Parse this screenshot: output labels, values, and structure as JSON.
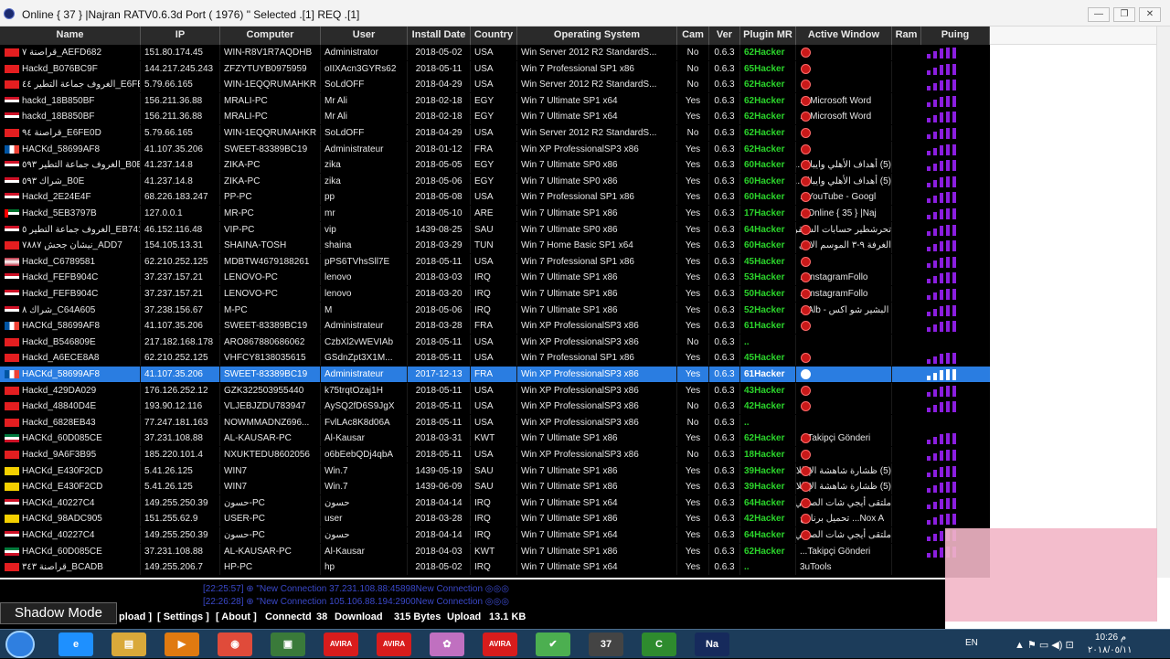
{
  "window": {
    "title": "Online { 37 } |Najran RATV0.6.3d  Port  ( 1976) \" Selected  .[1] REQ .[1]"
  },
  "columns": [
    {
      "key": "name",
      "label": "Name"
    },
    {
      "key": "ip",
      "label": "IP"
    },
    {
      "key": "computer",
      "label": "Computer"
    },
    {
      "key": "user",
      "label": "User"
    },
    {
      "key": "install",
      "label": "Install Date"
    },
    {
      "key": "country",
      "label": "Country"
    },
    {
      "key": "os",
      "label": "Operating System"
    },
    {
      "key": "cam",
      "label": "Cam"
    },
    {
      "key": "ver",
      "label": "Ver"
    },
    {
      "key": "plugin",
      "label": "Plugin MR"
    },
    {
      "key": "activewin",
      "label": "Active Window"
    },
    {
      "key": "ram",
      "label": "Ram"
    },
    {
      "key": "ping",
      "label": "Puing"
    }
  ],
  "rows": [
    {
      "flag": "tun",
      "name": "قراصنة ٧_AEFD682",
      "ip": "151.80.174.45",
      "computer": "WIN-R8V1R7AQDHB",
      "user": "Administrator",
      "install": "2018-05-02",
      "country": "USA",
      "os": "Win Server 2012 R2 StandardS...",
      "cam": "No",
      "ver": "0.6.3",
      "plugin": "62Hacker",
      "dot": true,
      "activewin": "",
      "ping": 4
    },
    {
      "flag": "tun",
      "name": "Hackd_B076BC9F",
      "ip": "144.217.245.243",
      "computer": "ZFZYTUYB0975959",
      "user": "oIIXAcn3GYRs62",
      "install": "2018-05-11",
      "country": "USA",
      "os": "Win 7 Professional SP1 x86",
      "cam": "No",
      "ver": "0.6.3",
      "plugin": "65Hacker",
      "dot": true,
      "activewin": "",
      "ping": 4
    },
    {
      "flag": "tun",
      "name": "الغروف جماعة التطير ٤٤_E6FE0D",
      "ip": "5.79.66.165",
      "computer": "WIN-1EQQRUMAHKR",
      "user": "SoLdOFF",
      "install": "2018-04-29",
      "country": "USA",
      "os": "Win Server 2012 R2 StandardS...",
      "cam": "No",
      "ver": "0.6.3",
      "plugin": "62Hacker",
      "dot": true,
      "activewin": "",
      "ping": 4
    },
    {
      "flag": "egy",
      "name": "hackd_18B850BF",
      "ip": "156.211.36.88",
      "computer": "MRALI-PC",
      "user": "Mr Ali",
      "install": "2018-02-18",
      "country": "EGY",
      "os": "Win 7 Ultimate SP1 x64",
      "cam": "Yes",
      "ver": "0.6.3",
      "plugin": "62Hacker",
      "dot": true,
      "activewin": "Microsoft Word ...",
      "ping": 4
    },
    {
      "flag": "egy",
      "name": "hackd_18B850BF",
      "ip": "156.211.36.88",
      "computer": "MRALI-PC",
      "user": "Mr Ali",
      "install": "2018-02-18",
      "country": "EGY",
      "os": "Win 7 Ultimate SP1 x64",
      "cam": "Yes",
      "ver": "0.6.3",
      "plugin": "62Hacker",
      "dot": true,
      "activewin": "Microsoft Word ...",
      "ping": 4
    },
    {
      "flag": "tun",
      "name": "قراصنة ٩٤_E6FE0D",
      "ip": "5.79.66.165",
      "computer": "WIN-1EQQRUMAHKR",
      "user": "SoLdOFF",
      "install": "2018-04-29",
      "country": "USA",
      "os": "Win Server 2012 R2 StandardS...",
      "cam": "No",
      "ver": "0.6.3",
      "plugin": "62Hacker",
      "dot": true,
      "activewin": "",
      "ping": 4
    },
    {
      "flag": "fra",
      "name": "HACKd_58699AF8",
      "ip": "41.107.35.206",
      "computer": "SWEET-83389BC19",
      "user": "Administrateur",
      "install": "2018-01-12",
      "country": "FRA",
      "os": "Win XP ProfessionalSP3 x86",
      "cam": "Yes",
      "ver": "0.6.3",
      "plugin": "62Hacker",
      "dot": true,
      "activewin": "",
      "ping": 4
    },
    {
      "flag": "egy",
      "name": "الغروف جماعة التطير ٥٩٣_B0E",
      "ip": "41.237.14.8",
      "computer": "ZIKA-PC",
      "user": "zika",
      "install": "2018-05-05",
      "country": "EGY",
      "os": "Win 7 Ultimate SP0 x86",
      "cam": "Yes",
      "ver": "0.6.3",
      "plugin": "60Hacker",
      "dot": true,
      "activewin": "(5) أهداف الأهلي وايباك ...",
      "ping": 4
    },
    {
      "flag": "egy",
      "name": "شراك ٥٩٣_B0E",
      "ip": "41.237.14.8",
      "computer": "ZIKA-PC",
      "user": "zika",
      "install": "2018-05-06",
      "country": "EGY",
      "os": "Win 7 Ultimate SP0 x86",
      "cam": "Yes",
      "ver": "0.6.3",
      "plugin": "60Hacker",
      "dot": true,
      "activewin": "(5) أهداف الأهلي وايباك ...",
      "ping": 4
    },
    {
      "flag": "egy",
      "name": "Hackd_2E24E4F",
      "ip": "68.226.183.247",
      "computer": "PP-PC",
      "user": "pp",
      "install": "2018-05-08",
      "country": "USA",
      "os": "Win 7 Professional SP1 x86",
      "cam": "Yes",
      "ver": "0.6.3",
      "plugin": "60Hacker",
      "dot": true,
      "activewin": "YouTube - Googl...",
      "ping": 4
    },
    {
      "flag": "are",
      "name": "Hackd_5EB3797B",
      "ip": "127.0.0.1",
      "computer": "MR-PC",
      "user": "mr",
      "install": "2018-05-10",
      "country": "ARE",
      "os": "Win 7 Ultimate SP1 x86",
      "cam": "Yes",
      "ver": "0.6.3",
      "plugin": "17Hacker",
      "dot": true,
      "activewin": "Online { 35 } |Naj...",
      "ping": 4
    },
    {
      "flag": "egy",
      "name": "الغروف جماعة التطير ٥_EB741...",
      "ip": "46.152.116.48",
      "computer": "VIP-PC",
      "user": "vip",
      "install": "1439-08-25",
      "country": "SAU",
      "os": "Win 7 Ultimate SP0 x86",
      "cam": "Yes",
      "ver": "0.6.3",
      "plugin": "64Hacker",
      "dot": true,
      "activewin": "تحرشطير حسابات الستقرا...",
      "ping": 4
    },
    {
      "flag": "tun",
      "name": "نيشان جحش ٧٨٨٧_ADD7",
      "ip": "154.105.13.31",
      "computer": "SHAINA-TOSH",
      "user": "shaina",
      "install": "2018-03-29",
      "country": "TUN",
      "os": "Win 7 Home Basic SP1 x64",
      "cam": "Yes",
      "ver": "0.6.3",
      "plugin": "60Hacker",
      "dot": true,
      "activewin": "الغرفة ٩-٣ الموسم الاول ...",
      "ping": 4
    },
    {
      "flag": "usa",
      "name": "Hackd_C6789581",
      "ip": "62.210.252.125",
      "computer": "MDBTW4679188261",
      "user": "pPS6TVhsSll7E",
      "install": "2018-05-11",
      "country": "USA",
      "os": "Win 7 Professional SP1 x86",
      "cam": "Yes",
      "ver": "0.6.3",
      "plugin": "45Hacker",
      "dot": true,
      "activewin": "",
      "ping": 4
    },
    {
      "flag": "egy",
      "name": "Hackd_FEFB904C",
      "ip": "37.237.157.21",
      "computer": "LENOVO-PC",
      "user": "lenovo",
      "install": "2018-03-03",
      "country": "IRQ",
      "os": "Win 7 Ultimate SP1 x86",
      "cam": "Yes",
      "ver": "0.6.3",
      "plugin": "53Hacker",
      "dot": true,
      "activewin": "InstagramFollo...",
      "ping": 4
    },
    {
      "flag": "egy",
      "name": "Hackd_FEFB904C",
      "ip": "37.237.157.21",
      "computer": "LENOVO-PC",
      "user": "lenovo",
      "install": "2018-03-20",
      "country": "IRQ",
      "os": "Win 7 Ultimate SP1 x86",
      "cam": "Yes",
      "ver": "0.6.3",
      "plugin": "50Hacker",
      "dot": true,
      "activewin": "InstagramFollo...",
      "ping": 4
    },
    {
      "flag": "egy",
      "name": "شراك ٨_C64A605",
      "ip": "37.238.156.67",
      "computer": "M-PC",
      "user": "M",
      "install": "2018-05-06",
      "country": "IRQ",
      "os": "Win 7 Ultimate SP1 x86",
      "cam": "Yes",
      "ver": "0.6.3",
      "plugin": "52Hacker",
      "dot": true,
      "activewin": "البشير شو اكس - Alb...",
      "ping": 4
    },
    {
      "flag": "fra",
      "name": "HACKd_58699AF8",
      "ip": "41.107.35.206",
      "computer": "SWEET-83389BC19",
      "user": "Administrateur",
      "install": "2018-03-28",
      "country": "FRA",
      "os": "Win XP ProfessionalSP3 x86",
      "cam": "Yes",
      "ver": "0.6.3",
      "plugin": "61Hacker",
      "dot": true,
      "activewin": "",
      "ping": 4
    },
    {
      "flag": "tun",
      "name": "Hackd_B546809E",
      "ip": "217.182.168.178",
      "computer": "ARO867880686062",
      "user": "CzbXl2vWEVIAb",
      "install": "2018-05-11",
      "country": "USA",
      "os": "Win XP ProfessionalSP3 x86",
      "cam": "No",
      "ver": "0.6.3",
      "plugin": "..",
      "dot": false,
      "activewin": "",
      "ping": 0
    },
    {
      "flag": "tun",
      "name": "Hackd_A6ECE8A8",
      "ip": "62.210.252.125",
      "computer": "VHFCY8138035615",
      "user": "GSdnZpt3X1M...",
      "install": "2018-05-11",
      "country": "USA",
      "os": "Win 7 Professional SP1 x86",
      "cam": "Yes",
      "ver": "0.6.3",
      "plugin": "45Hacker",
      "dot": true,
      "activewin": "",
      "ping": 4
    },
    {
      "flag": "fra",
      "name": "HACKd_58699AF8",
      "ip": "41.107.35.206",
      "computer": "SWEET-83389BC19",
      "user": "Administrateur",
      "install": "2017-12-13",
      "country": "FRA",
      "os": "Win XP ProfessionalSP3 x86",
      "cam": "Yes",
      "ver": "0.6.3",
      "plugin": "61Hacker",
      "dot": true,
      "activewin": "",
      "ping": 4,
      "selected": true
    },
    {
      "flag": "tun",
      "name": "Hackd_429DA029",
      "ip": "176.126.252.12",
      "computer": "GZK322503955440",
      "user": "k75trqtOzaj1H",
      "install": "2018-05-11",
      "country": "USA",
      "os": "Win XP ProfessionalSP3 x86",
      "cam": "Yes",
      "ver": "0.6.3",
      "plugin": "43Hacker",
      "dot": true,
      "activewin": "",
      "ping": 4
    },
    {
      "flag": "tun",
      "name": "Hackd_48840D4E",
      "ip": "193.90.12.116",
      "computer": "VLJEBJZDU783947",
      "user": "AySQ2fD6S9JgX",
      "install": "2018-05-11",
      "country": "USA",
      "os": "Win XP ProfessionalSP3 x86",
      "cam": "No",
      "ver": "0.6.3",
      "plugin": "42Hacker",
      "dot": true,
      "activewin": "",
      "ping": 4
    },
    {
      "flag": "tun",
      "name": "Hackd_6828EB43",
      "ip": "77.247.181.163",
      "computer": "NOWMMADNZ696...",
      "user": "FvlLAc8K8d06A",
      "install": "2018-05-11",
      "country": "USA",
      "os": "Win XP ProfessionalSP3 x86",
      "cam": "No",
      "ver": "0.6.3",
      "plugin": "..",
      "dot": false,
      "activewin": "",
      "ping": 0
    },
    {
      "flag": "kwt",
      "name": "HACKd_60D085CE",
      "ip": "37.231.108.88",
      "computer": "AL-KAUSAR-PC",
      "user": "Al-Kausar",
      "install": "2018-03-31",
      "country": "KWT",
      "os": "Win 7 Ultimate SP1 x86",
      "cam": "Yes",
      "ver": "0.6.3",
      "plugin": "62Hacker",
      "dot": true,
      "activewin": "Takipçi Gönderi...",
      "ping": 4
    },
    {
      "flag": "tun",
      "name": "Hackd_9A6F3B95",
      "ip": "185.220.101.4",
      "computer": "NXUKTEDU8602056",
      "user": "o6bEebQDj4qbA",
      "install": "2018-05-11",
      "country": "USA",
      "os": "Win XP ProfessionalSP3 x86",
      "cam": "No",
      "ver": "0.6.3",
      "plugin": "18Hacker",
      "dot": true,
      "activewin": "",
      "ping": 4
    },
    {
      "flag": "sau",
      "name": "HACKd_E430F2CD",
      "ip": "5.41.26.125",
      "computer": "WIN7",
      "user": "Win.7",
      "install": "1439-05-19",
      "country": "SAU",
      "os": "Win 7 Ultimate SP1 x86",
      "cam": "Yes",
      "ver": "0.6.3",
      "plugin": "39Hacker",
      "dot": true,
      "activewin": "(5) ظشارة شاهشة الإطلاة ...",
      "ping": 4
    },
    {
      "flag": "sau",
      "name": "HACKd_E430F2CD",
      "ip": "5.41.26.125",
      "computer": "WIN7",
      "user": "Win.7",
      "install": "1439-06-09",
      "country": "SAU",
      "os": "Win 7 Ultimate SP1 x86",
      "cam": "Yes",
      "ver": "0.6.3",
      "plugin": "39Hacker",
      "dot": true,
      "activewin": "(5) ظشارة شاهشة الإطلاة ...",
      "ping": 4
    },
    {
      "flag": "egy",
      "name": "HACKd_40227C4",
      "ip": "149.255.250.39",
      "computer": "حسون-PC",
      "user": "حسون",
      "install": "2018-04-14",
      "country": "IRQ",
      "os": "Win 7 Ultimate SP1 x64",
      "cam": "Yes",
      "ver": "0.6.3",
      "plugin": "64Hacker",
      "dot": true,
      "activewin": "ملتقى أيجي شات الصوتي ...",
      "ping": 4
    },
    {
      "flag": "sau",
      "name": "HACKd_98ADC905",
      "ip": "151.255.62.9",
      "computer": "USER-PC",
      "user": "user",
      "install": "2018-03-28",
      "country": "IRQ",
      "os": "Win 7 Ultimate SP1 x86",
      "cam": "Yes",
      "ver": "0.6.3",
      "plugin": "42Hacker",
      "dot": true,
      "activewin": "Nox A... تحميل برنامج",
      "ping": 4
    },
    {
      "flag": "egy",
      "name": "HACKd_40227C4",
      "ip": "149.255.250.39",
      "computer": "حسون-PC",
      "user": "حسون",
      "install": "2018-04-14",
      "country": "IRQ",
      "os": "Win 7 Ultimate SP1 x64",
      "cam": "Yes",
      "ver": "0.6.3",
      "plugin": "64Hacker",
      "dot": true,
      "activewin": "ملتقى أيجي شات الصوتي ...",
      "ping": 4
    },
    {
      "flag": "kwt",
      "name": "HACKd_60D085CE",
      "ip": "37.231.108.88",
      "computer": "AL-KAUSAR-PC",
      "user": "Al-Kausar",
      "install": "2018-04-03",
      "country": "KWT",
      "os": "Win 7 Ultimate SP1 x86",
      "cam": "Yes",
      "ver": "0.6.3",
      "plugin": "62Hacker",
      "dot": false,
      "activewin": "Takipçi Gönderi...",
      "ping": 4
    },
    {
      "flag": "tun",
      "name": "قراصنة ٣٤٣_BCADB",
      "ip": "149.255.206.7",
      "computer": "HP-PC",
      "user": "hp",
      "install": "2018-05-02",
      "country": "IRQ",
      "os": "Win 7 Ultimate SP1 x64",
      "cam": "Yes",
      "ver": "0.6.3",
      "plugin": "..",
      "dot": false,
      "activewin": "3uTools",
      "ping": 0
    }
  ],
  "log": [
    "[22:25:57]  ⊕ \"New Connection 37.231.108.88:45898New Connection ◎◎◎",
    "[22:26:28]  ⊕ \"New Connection 105.106.88.194:2900New Connection ◎◎◎"
  ],
  "status": {
    "upload_tab": "pload ]",
    "settings": "[ Settings ]",
    "about": "[ About ]",
    "connected_label": "Connectd",
    "connected_count": "38",
    "download_label": "Download",
    "download_value": "315 Bytes",
    "upload_label": "Upload",
    "upload_value": "13.1 KB"
  },
  "shadow_mode": "Shadow Mode",
  "taskbar": {
    "apps": [
      {
        "name": "ie-icon",
        "label": "e",
        "color": "#1e90ff"
      },
      {
        "name": "explorer-icon",
        "label": "▤",
        "color": "#d9a93a"
      },
      {
        "name": "media-player-icon",
        "label": "▶",
        "color": "#e07a10"
      },
      {
        "name": "chrome-icon",
        "label": "◉",
        "color": "#e04b3a"
      },
      {
        "name": "app-icon",
        "label": "▣",
        "color": "#3a7a3a"
      },
      {
        "name": "avira-icon",
        "label": "AVIRA",
        "color": "#d81c1c"
      },
      {
        "name": "avira-icon",
        "label": "AVIRA",
        "color": "#d81c1c"
      },
      {
        "name": "app-icon",
        "label": "✿",
        "color": "#c070c0"
      },
      {
        "name": "avira-icon",
        "label": "AVIRA",
        "color": "#d81c1c"
      },
      {
        "name": "app-icon",
        "label": "✔",
        "color": "#4caf50"
      },
      {
        "name": "app-icon",
        "label": "37",
        "color": "#444"
      },
      {
        "name": "app-icon",
        "label": "C",
        "color": "#2e8b2e"
      },
      {
        "name": "najran-icon",
        "label": "Na",
        "color": "#162a5c"
      }
    ],
    "lang": "EN",
    "time": "10:26 م",
    "date": "٢٠١٨/٠٥/١١"
  }
}
